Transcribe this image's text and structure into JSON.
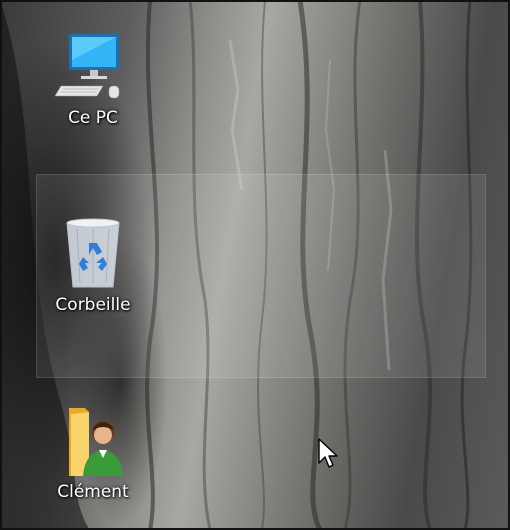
{
  "desktop": {
    "icons": [
      {
        "label": "Ce PC",
        "icon": "computer-icon"
      },
      {
        "label": "Corbeille",
        "icon": "recycle-bin-icon"
      },
      {
        "label": "Clément",
        "icon": "user-folder-icon"
      }
    ],
    "cursor": "mouse-pointer-icon"
  },
  "colors": {
    "monitor_screen": "#2aa7f0",
    "bin_recycle_symbol": "#2f7fd8",
    "folder": "#f2c44b",
    "user_shirt": "#3a9b3a"
  }
}
